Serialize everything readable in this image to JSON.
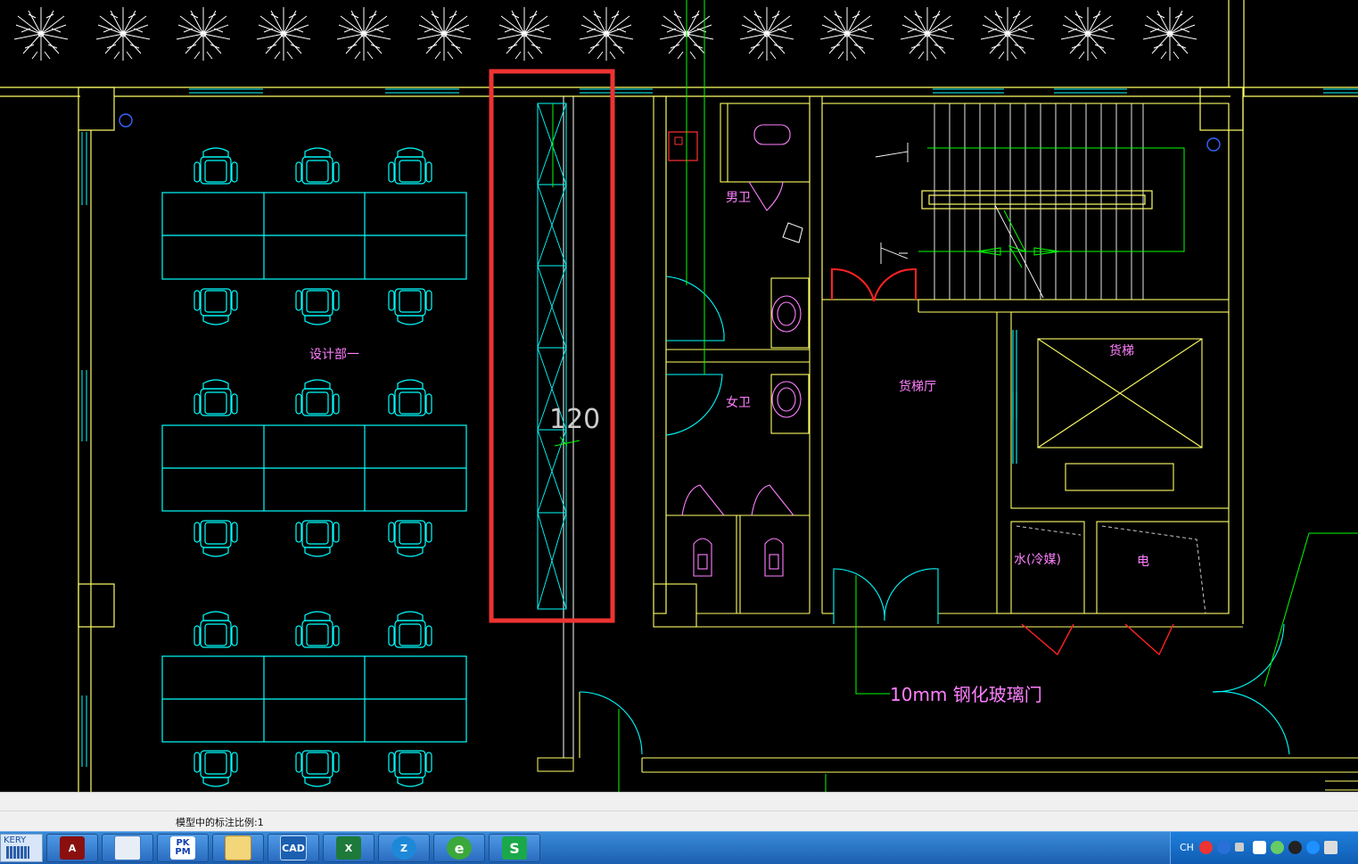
{
  "drawing": {
    "rooms": {
      "design_dept": "设计部一",
      "mens_toilet": "男卫",
      "womens_toilet": "女卫",
      "freight_hall": "货梯厅",
      "freight_elevator": "货梯",
      "water_shaft": "水(冷媒)",
      "electric_shaft": "电"
    },
    "dimension": "120",
    "annotation": "10mm 钢化玻璃门",
    "colors": {
      "cyan": "#00ffff",
      "yellow": "#ffff66",
      "magenta": "#ff80ff",
      "green": "#00ff00",
      "red": "#ff0000",
      "white": "#ffffff",
      "highlight": "#ee3333"
    }
  },
  "status": {
    "text": "模型中的标注比例:1"
  },
  "taskbar": {
    "kery_label": "KERY",
    "buttons": [
      {
        "name": "autocad",
        "icon": "autocad-icon",
        "label": "A"
      },
      {
        "name": "explorer",
        "icon": "folder-doc-icon",
        "label": ""
      },
      {
        "name": "pkpm",
        "icon": "pkpm-icon",
        "label": "PK PM"
      },
      {
        "name": "files",
        "icon": "files-icon",
        "label": ""
      },
      {
        "name": "cad-viewer",
        "icon": "cad-icon",
        "label": "CAD"
      },
      {
        "name": "excel",
        "icon": "excel-icon",
        "label": "X"
      },
      {
        "name": "app-z",
        "icon": "z-app-icon",
        "label": "Z"
      },
      {
        "name": "browser",
        "icon": "browser-icon",
        "label": "e"
      },
      {
        "name": "wps",
        "icon": "wps-icon",
        "label": "S"
      }
    ],
    "tray": {
      "lang": "CH"
    }
  }
}
